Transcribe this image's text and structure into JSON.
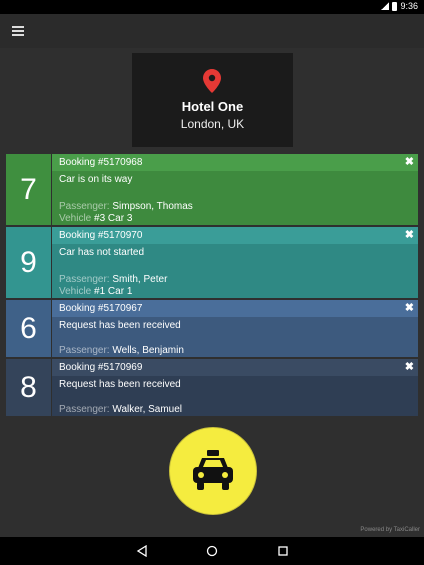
{
  "status": {
    "time": "9:36"
  },
  "hotel": {
    "name": "Hotel One",
    "city": "London, UK"
  },
  "bookings": [
    {
      "number": "7",
      "title": "Booking #5170968",
      "status": "Car is on its way",
      "passenger_label": "Passenger:",
      "passenger": "Simpson, Thomas",
      "vehicle_label": "Vehicle",
      "vehicle": "#3 Car 3",
      "color_head": "#4a9e4a",
      "color_body": "#3e8a3e",
      "color_num": "#3f8f3f"
    },
    {
      "number": "9",
      "title": "Booking #5170970",
      "status": "Car has not started",
      "passenger_label": "Passenger:",
      "passenger": "Smith, Peter",
      "vehicle_label": "Vehicle",
      "vehicle": "#1 Car 1",
      "color_head": "#3a9d98",
      "color_body": "#2f8984",
      "color_num": "#339590"
    },
    {
      "number": "6",
      "title": "Booking #5170967",
      "status": "Request has been received",
      "passenger_label": "Passenger:",
      "passenger": "Wells, Benjamin",
      "color_head": "#4a6e9a",
      "color_body": "#3d5a7e",
      "color_num": "#3f6188"
    },
    {
      "number": "8",
      "title": "Booking #5170969",
      "status": "Request has been received",
      "passenger_label": "Passenger:",
      "passenger": "Walker, Samuel",
      "color_head": "#3a4b63",
      "color_body": "#2f3e54",
      "color_num": "#34445a"
    }
  ],
  "footer": {
    "powered": "Powered by TaxiCaller"
  },
  "colors": {
    "taxi_yellow": "#f5ec3f",
    "pin_red": "#e53935"
  }
}
